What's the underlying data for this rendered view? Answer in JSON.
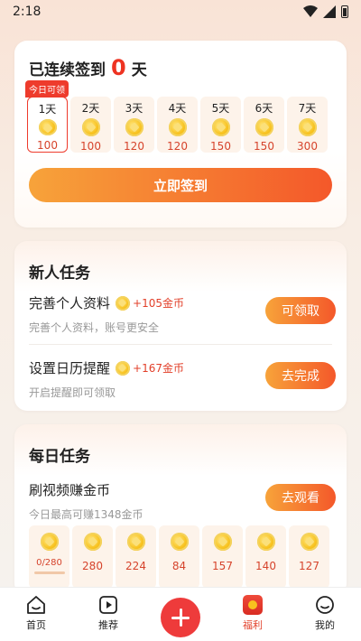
{
  "status_bar": {
    "time": "2:18"
  },
  "checkin": {
    "title_prefix": "已连续签到",
    "count": "0",
    "title_suffix": "天",
    "today_badge": "今日可领",
    "days": [
      {
        "label": "1天",
        "amount": "100"
      },
      {
        "label": "2天",
        "amount": "100"
      },
      {
        "label": "3天",
        "amount": "120"
      },
      {
        "label": "4天",
        "amount": "120"
      },
      {
        "label": "5天",
        "amount": "150"
      },
      {
        "label": "6天",
        "amount": "150"
      },
      {
        "label": "7天",
        "amount": "300"
      }
    ],
    "button": "立即签到"
  },
  "newbie": {
    "title": "新人任务",
    "tasks": [
      {
        "name": "完善个人资料",
        "reward": "+105金币",
        "desc": "完善个人资料，账号更安全",
        "button": "可领取"
      },
      {
        "name": "设置日历提醒",
        "reward": "+167金币",
        "desc": "开启提醒即可领取",
        "button": "去完成"
      }
    ]
  },
  "daily": {
    "title": "每日任务",
    "task": {
      "name": "刷视频赚金币",
      "desc": "今日最高可赚1348金币",
      "button": "去观看"
    },
    "rewards": [
      "0/280",
      "280",
      "224",
      "84",
      "157",
      "140",
      "127"
    ],
    "progress": 0
  },
  "tabbar": {
    "items": [
      {
        "label": "首页"
      },
      {
        "label": "推荐"
      },
      {
        "label": ""
      },
      {
        "label": "福利"
      },
      {
        "label": "我的"
      }
    ]
  },
  "colors": {
    "accent": "#ee3b2c",
    "gradient_start": "#f7a33a",
    "gradient_end": "#f4582a",
    "coin": "#f8c21e"
  }
}
